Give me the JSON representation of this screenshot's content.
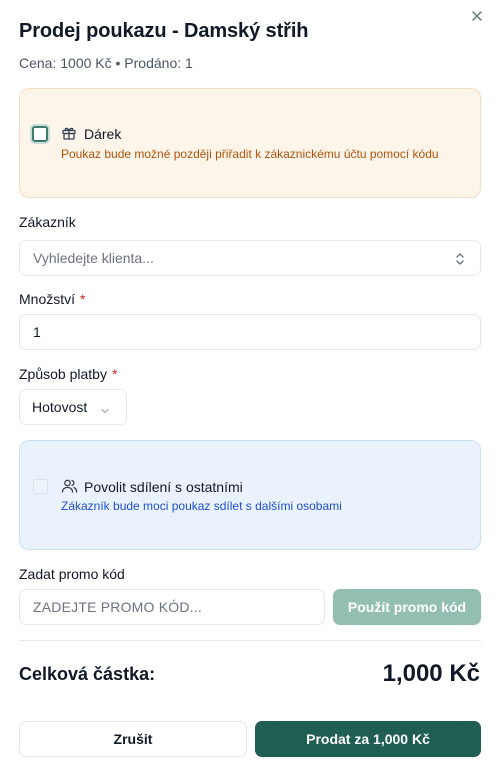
{
  "dialog": {
    "title": "Prodej poukazu - Damský střih",
    "subtitle": "Cena: 1000 Kč • Prodáno: 1"
  },
  "gift": {
    "checked": false,
    "label": "Dárek",
    "description": "Poukaz bude možné později přiřadit k zákaznickému účtu pomocí kódu",
    "icon": "gift-icon"
  },
  "customer": {
    "label": "Zákazník",
    "placeholder": "Vyhledejte klienta..."
  },
  "quantity": {
    "label": "Množství",
    "required_mark": "*",
    "value": "1"
  },
  "payment": {
    "label": "Způsob platby",
    "required_mark": "*",
    "selected": "Hotovost"
  },
  "sharing": {
    "checked": false,
    "label": "Povolit sdílení s ostatními",
    "description": "Zákazník bude moci poukaz sdílet s dalšími osobami",
    "icon": "users-icon"
  },
  "promo": {
    "label": "Zadat promo kód",
    "placeholder": "ZADEJTE PROMO KÓD...",
    "apply_label": "Použít promo kód"
  },
  "total": {
    "label": "Celková částka:",
    "value": "1,000 Kč"
  },
  "actions": {
    "cancel_label": "Zrušit",
    "sell_label": "Prodat za 1,000 Kč"
  },
  "colors": {
    "primary": "#1f5e52",
    "primary_disabled": "#93bfb3",
    "gift_bg": "#fdf4ea",
    "gift_text": "#b45309",
    "share_bg": "#eaf3fd",
    "share_text": "#1d4ed8",
    "required": "#dc2626"
  }
}
